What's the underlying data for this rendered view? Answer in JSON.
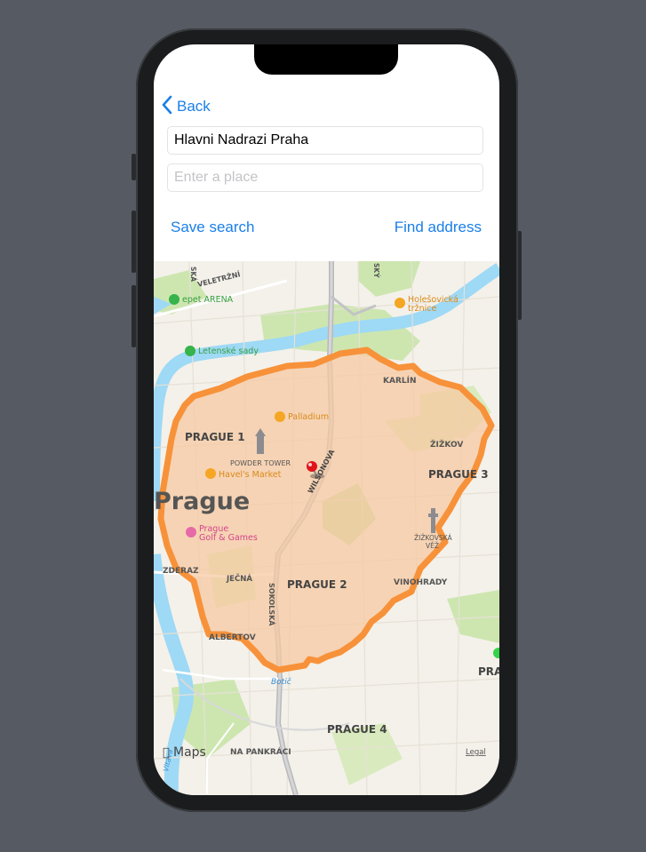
{
  "navigation": {
    "back_label": "Back"
  },
  "search": {
    "from_value": "Hlavni Nadrazi Praha",
    "to_value": "",
    "to_placeholder": "Enter a place"
  },
  "actions": {
    "save_label": "Save search",
    "find_label": "Find address"
  },
  "map": {
    "city_label": "Prague",
    "districts": {
      "prague1": "PRAGUE 1",
      "prague2": "PRAGUE 2",
      "prague3": "PRAGUE 3",
      "prague4": "PRAGUE 4",
      "pra_cut": "PRA"
    },
    "neighborhoods": {
      "karlin": "KARLÍN",
      "zizkov": "ŽIŽKOV",
      "vinohrady": "VINOHRADY",
      "zderaz": "ZDERAZ",
      "albertov": "ALBERTOV",
      "na_pankraci": "NA PANKRÁCI"
    },
    "streets": {
      "veletrzni": "VELETRŽNÍ",
      "jecna": "JEČNÁ",
      "sokolska": "SOKOLSKÁ",
      "wilsonova": "WILSONOVA",
      "ska": "SKÁ",
      "sky": "SKÝ"
    },
    "pois": {
      "tipsport": "epet ARENA",
      "holesovicka": "Holešovická tržnice",
      "holesovicka_line1": "Holešovická",
      "holesovicka_line2": "tržnice",
      "letenske": "Letenské sady",
      "palladium": "Palladium",
      "powder_tower": "POWDER TOWER",
      "havels": "Havel's Market",
      "golf_line1": "Prague",
      "golf_line2": "Golf & Games",
      "tv_tower_line1": "ŽIŽKOVSKÁ",
      "tv_tower_line2": "VĚŽ",
      "botic": "Botič",
      "vltava": "Vltava"
    },
    "attribution": "Maps",
    "legal": "Legal",
    "colors": {
      "route": "#f7923a",
      "area_fill": "#f6c79f",
      "water": "#9ed9f5",
      "park": "#cde6b0",
      "land": "#f4f1ea",
      "pin": "#e0141c"
    }
  }
}
